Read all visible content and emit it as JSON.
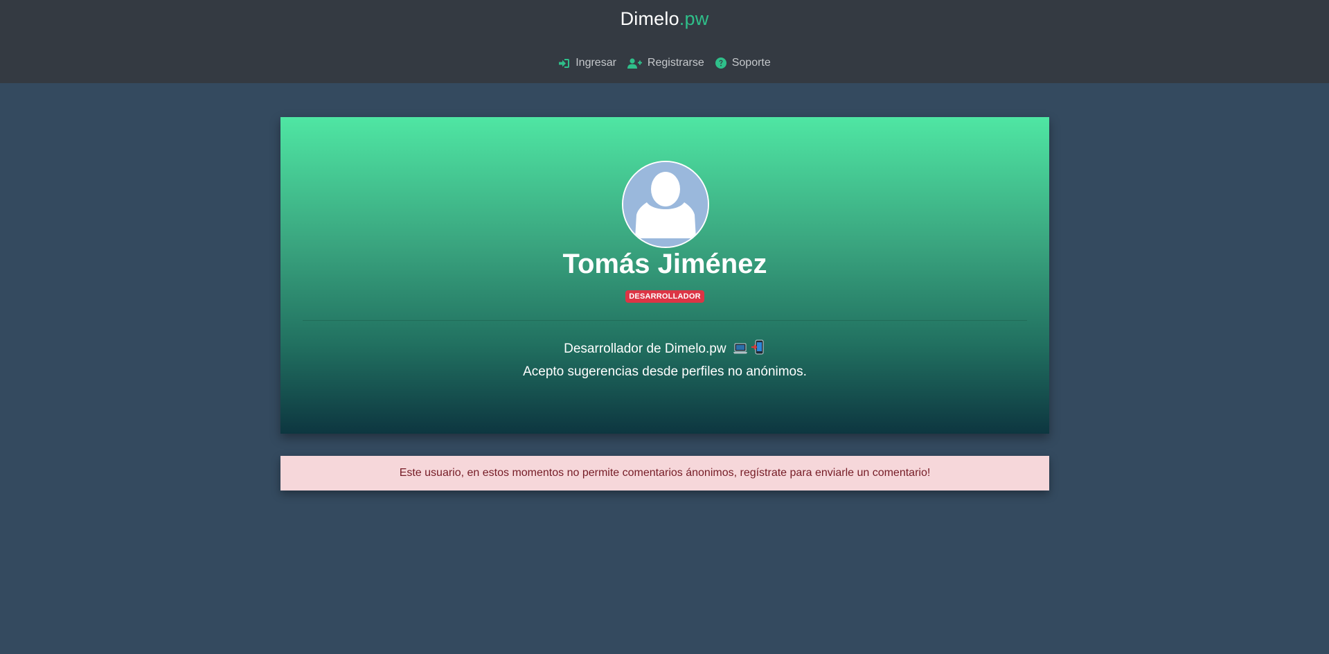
{
  "header": {
    "brand_main": "Dimelo",
    "brand_suffix": ".pw",
    "brand_color": "#2fbf8a",
    "nav": [
      {
        "label": "Ingresar",
        "icon": "sign-in-icon"
      },
      {
        "label": "Registrarse",
        "icon": "user-plus-icon"
      },
      {
        "label": "Soporte",
        "icon": "question-circle-icon"
      }
    ]
  },
  "profile": {
    "name": "Tomás Jiménez",
    "badge": "DESARROLLADOR",
    "badge_color": "#dc3545",
    "bio_line1": "Desarrollador de Dimelo.pw",
    "bio_line2": "Acepto sugerencias desde perfiles no anónimos.",
    "bio_icons": [
      "laptop-icon",
      "mobile-phone-icon"
    ]
  },
  "alert": {
    "message": "Este usuario, en estos momentos no permite comentarios ánonimos, regístrate para enviarle un comentario!"
  }
}
